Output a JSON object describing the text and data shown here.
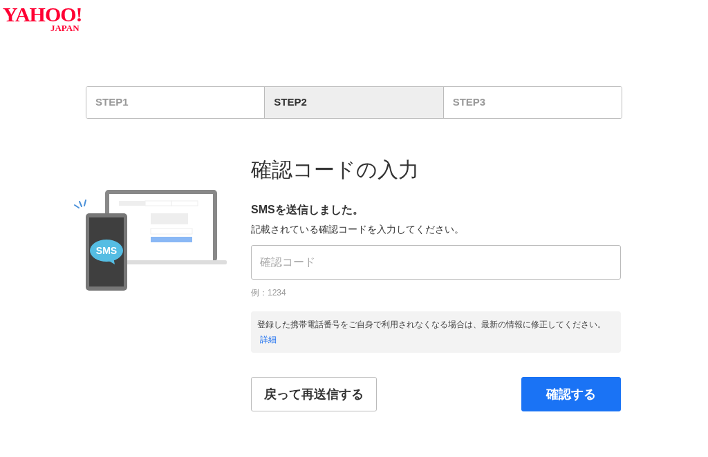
{
  "logo": {
    "name": "YAHOO!",
    "region": "JAPAN"
  },
  "steps": [
    {
      "label": "STEP1",
      "selected": false
    },
    {
      "label": "STEP2",
      "selected": true
    },
    {
      "label": "STEP3",
      "selected": false
    }
  ],
  "title": "確認コードの入力",
  "illustration": {
    "bubble": "SMS"
  },
  "message": "SMSを送信しました。",
  "instruction": "記載されている確認コードを入力してください。",
  "code_field": {
    "placeholder": "確認コード"
  },
  "hint": "例：1234",
  "notice": {
    "text": "登録した携帯電話番号をご自身で利用されなくなる場合は、最新の情報に修正してください。",
    "link": "詳細"
  },
  "buttons": [
    {
      "label": "戻って再送信する",
      "kind": "secondary"
    },
    {
      "label": "確認する",
      "kind": "primary"
    }
  ]
}
